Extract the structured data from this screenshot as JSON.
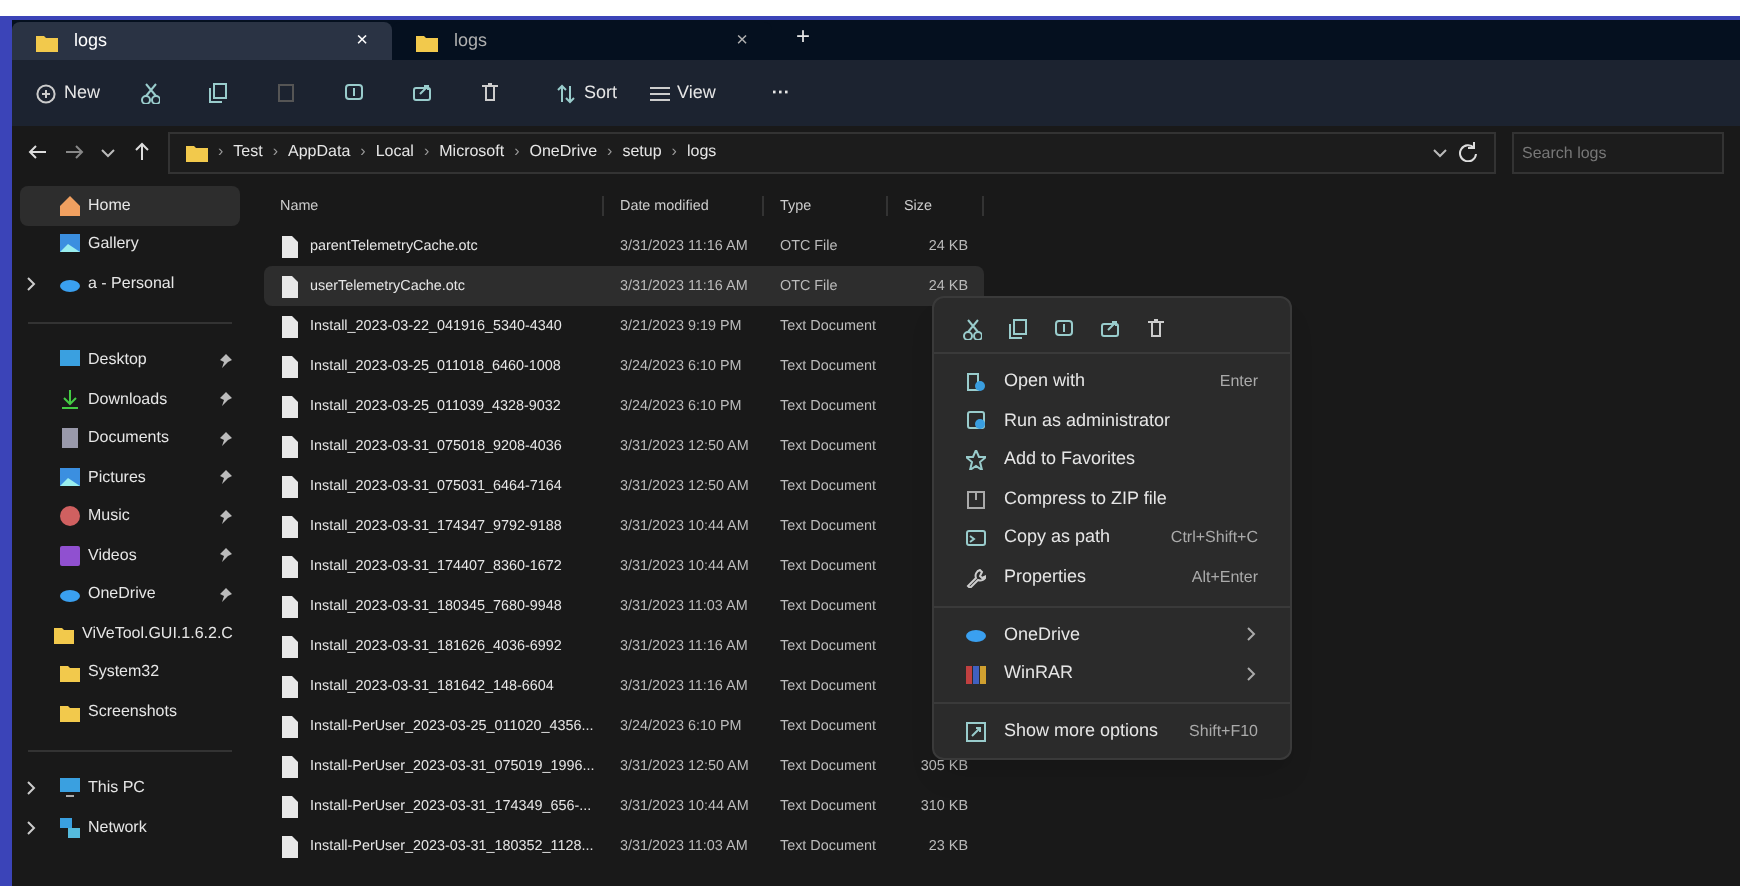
{
  "tabs": [
    {
      "label": "logs",
      "selected": true,
      "close": "×"
    },
    {
      "label": "logs",
      "selected": false,
      "close": "×"
    }
  ],
  "new_tab": "+",
  "toolbar": {
    "new": "New",
    "sort": "Sort",
    "view": "View",
    "more": "···"
  },
  "address": {
    "separator": "›",
    "crumbs": [
      "Test",
      "AppData",
      "Local",
      "Microsoft",
      "OneDrive",
      "setup",
      "logs"
    ]
  },
  "search": {
    "placeholder": "Search logs"
  },
  "sidebar": {
    "groups": [
      [
        {
          "label": "Home",
          "selected": true,
          "expandable": false,
          "pinned": false
        },
        {
          "label": "Gallery",
          "selected": false,
          "expandable": false,
          "pinned": false
        },
        {
          "label": "a - Personal",
          "selected": false,
          "expandable": true,
          "pinned": false
        }
      ],
      [
        {
          "label": "Desktop",
          "selected": false,
          "expandable": false,
          "pinned": true
        },
        {
          "label": "Downloads",
          "selected": false,
          "expandable": false,
          "pinned": true
        },
        {
          "label": "Documents",
          "selected": false,
          "expandable": false,
          "pinned": true
        },
        {
          "label": "Pictures",
          "selected": false,
          "expandable": false,
          "pinned": true
        },
        {
          "label": "Music",
          "selected": false,
          "expandable": false,
          "pinned": true
        },
        {
          "label": "Videos",
          "selected": false,
          "expandable": false,
          "pinned": true
        },
        {
          "label": "OneDrive",
          "selected": false,
          "expandable": false,
          "pinned": true
        },
        {
          "label": "ViVeTool.GUI.1.6.2.C",
          "selected": false,
          "expandable": false,
          "pinned": false
        },
        {
          "label": "System32",
          "selected": false,
          "expandable": false,
          "pinned": false
        },
        {
          "label": "Screenshots",
          "selected": false,
          "expandable": false,
          "pinned": false
        }
      ],
      [
        {
          "label": "This PC",
          "selected": false,
          "expandable": true,
          "pinned": false
        },
        {
          "label": "Network",
          "selected": false,
          "expandable": true,
          "pinned": false
        }
      ]
    ]
  },
  "table": {
    "columns": [
      "Name",
      "Date modified",
      "Type",
      "Size"
    ],
    "rows": [
      {
        "name": "parentTelemetryCache.otc",
        "date": "3/31/2023 11:16 AM",
        "type": "OTC File",
        "size": "24 KB",
        "selected": false
      },
      {
        "name": "userTelemetryCache.otc",
        "date": "3/31/2023 11:16 AM",
        "type": "OTC File",
        "size": "24 KB",
        "selected": true
      },
      {
        "name": "Install_2023-03-22_041916_5340-4340",
        "date": "3/21/2023 9:19 PM",
        "type": "Text Document",
        "selected": false
      },
      {
        "name": "Install_2023-03-25_011018_6460-1008",
        "date": "3/24/2023 6:10 PM",
        "type": "Text Document",
        "selected": false
      },
      {
        "name": "Install_2023-03-25_011039_4328-9032",
        "date": "3/24/2023 6:10 PM",
        "type": "Text Document",
        "selected": false
      },
      {
        "name": "Install_2023-03-31_075018_9208-4036",
        "date": "3/31/2023 12:50 AM",
        "type": "Text Document",
        "selected": false
      },
      {
        "name": "Install_2023-03-31_075031_6464-7164",
        "date": "3/31/2023 12:50 AM",
        "type": "Text Document",
        "selected": false
      },
      {
        "name": "Install_2023-03-31_174347_9792-9188",
        "date": "3/31/2023 10:44 AM",
        "type": "Text Document",
        "selected": false
      },
      {
        "name": "Install_2023-03-31_174407_8360-1672",
        "date": "3/31/2023 10:44 AM",
        "type": "Text Document",
        "selected": false
      },
      {
        "name": "Install_2023-03-31_180345_7680-9948",
        "date": "3/31/2023 11:03 AM",
        "type": "Text Document",
        "selected": false
      },
      {
        "name": "Install_2023-03-31_181626_4036-6992",
        "date": "3/31/2023 11:16 AM",
        "type": "Text Document",
        "selected": false
      },
      {
        "name": "Install_2023-03-31_181642_148-6604",
        "date": "3/31/2023 11:16 AM",
        "type": "Text Document",
        "selected": false
      },
      {
        "name": "Install-PerUser_2023-03-25_011020_4356...",
        "date": "3/24/2023 6:10 PM",
        "type": "Text Document",
        "selected": false
      },
      {
        "name": "Install-PerUser_2023-03-31_075019_1996...",
        "date": "3/31/2023 12:50 AM",
        "type": "Text Document",
        "size": "305 KB",
        "selected": false
      },
      {
        "name": "Install-PerUser_2023-03-31_174349_656-...",
        "date": "3/31/2023 10:44 AM",
        "type": "Text Document",
        "size": "310 KB",
        "selected": false
      },
      {
        "name": "Install-PerUser_2023-03-31_180352_1128...",
        "date": "3/31/2023 11:03 AM",
        "type": "Text Document",
        "size": "23 KB",
        "selected": false
      }
    ]
  },
  "context_menu": {
    "items": [
      {
        "kind": "item",
        "label": "Open with",
        "shortcut": "Enter"
      },
      {
        "kind": "item",
        "label": "Run as administrator"
      },
      {
        "kind": "item",
        "label": "Add to Favorites"
      },
      {
        "kind": "item",
        "label": "Compress to ZIP file"
      },
      {
        "kind": "item",
        "label": "Copy as path",
        "shortcut": "Ctrl+Shift+C"
      },
      {
        "kind": "item",
        "label": "Properties",
        "shortcut": "Alt+Enter"
      },
      {
        "kind": "separator"
      },
      {
        "kind": "submenu",
        "label": "OneDrive"
      },
      {
        "kind": "submenu",
        "label": "WinRAR"
      },
      {
        "kind": "separator"
      },
      {
        "kind": "item",
        "label": "Show more options",
        "shortcut": "Shift+F10"
      }
    ]
  }
}
